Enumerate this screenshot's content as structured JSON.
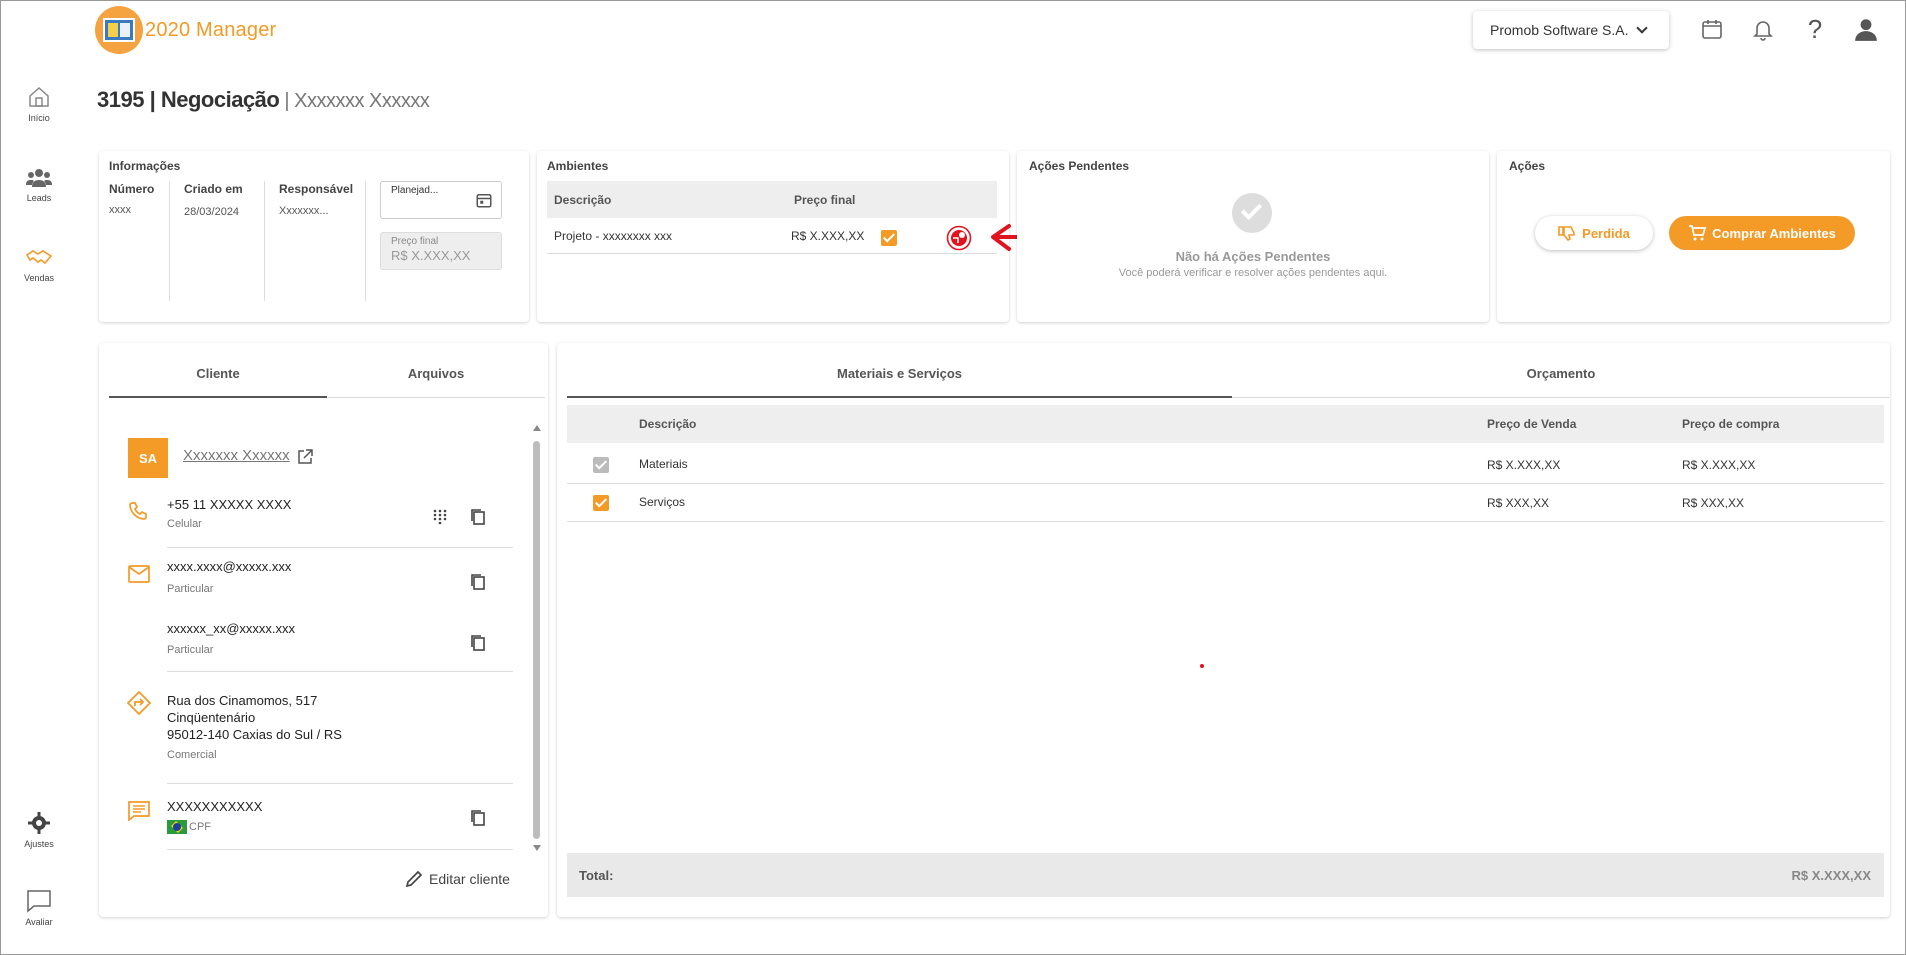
{
  "app": {
    "name": "2020 Manager",
    "company": "Promob Software S.A."
  },
  "nav": [
    {
      "label": "Início",
      "icon": "home-icon"
    },
    {
      "label": "Leads",
      "icon": "people-icon"
    },
    {
      "label": "Vendas",
      "icon": "handshake-icon"
    },
    {
      "label": "Ajustes",
      "icon": "gear-icon"
    },
    {
      "label": "Avaliar",
      "icon": "feedback-icon"
    }
  ],
  "title": {
    "id": "3195",
    "section": "Negociação",
    "client": "Xxxxxxx Xxxxxx"
  },
  "info": {
    "title": "Informações",
    "numero_label": "Número",
    "numero": "xxxx",
    "criado_label": "Criado em",
    "criado": "28/03/2024",
    "resp_label": "Responsável",
    "resp": "Xxxxxxx...",
    "planejado_label": "Planejad...",
    "preco_label": "Preço final",
    "preco": "R$ X.XXX,XX"
  },
  "ambientes": {
    "title": "Ambientes",
    "col_desc": "Descrição",
    "col_preco": "Preço final",
    "rows": [
      {
        "prefix": "Projeto",
        "desc": " - xxxxxxxx xxx",
        "preco": "R$ X.XXX,XX"
      }
    ]
  },
  "pendentes": {
    "title": "Ações Pendentes",
    "empty_title": "Não há Ações Pendentes",
    "empty_sub": "Você poderá verificar e resolver ações pendentes aqui."
  },
  "acoes": {
    "title": "Ações",
    "perdida": "Perdida",
    "comprar": "Comprar Ambientes"
  },
  "left_tabs": {
    "cliente": "Cliente",
    "arquivos": "Arquivos"
  },
  "client": {
    "initials": "SA",
    "name": "Xxxxxxx Xxxxxx",
    "phone": "+55 11 XXXXX XXXX",
    "phone_type": "Celular",
    "email1": "xxxx.xxxx@xxxxx.xxx",
    "email1_type": "Particular",
    "email2": "xxxxxx_xx@xxxxx.xxx",
    "email2_type": "Particular",
    "addr1": "Rua dos Cinamomos, 517",
    "addr2": "Cinqüentenário",
    "addr3": "95012-140 Caxias do Sul / RS",
    "addr_type": "Comercial",
    "doc": "XXXXXXXXXXX",
    "doc_type": "CPF",
    "edit": "Editar cliente"
  },
  "right_tabs": {
    "materiais": "Materiais e Serviços",
    "orcamento": "Orçamento"
  },
  "materials": {
    "col_desc": "Descrição",
    "col_venda": "Preço de Venda",
    "col_compra": "Preço de compra",
    "rows": [
      {
        "desc": "Materiais",
        "venda": "R$ X.XXX,XX",
        "compra": "R$ X.XXX,XX"
      },
      {
        "desc": "Serviços",
        "venda": "R$ XXX,XX",
        "compra": "R$ XXX,XX"
      }
    ],
    "total_label": "Total:",
    "total": "R$ X.XXX,XX"
  },
  "colors": {
    "accent": "#f49a26",
    "annotation_red": "#e0141e"
  }
}
